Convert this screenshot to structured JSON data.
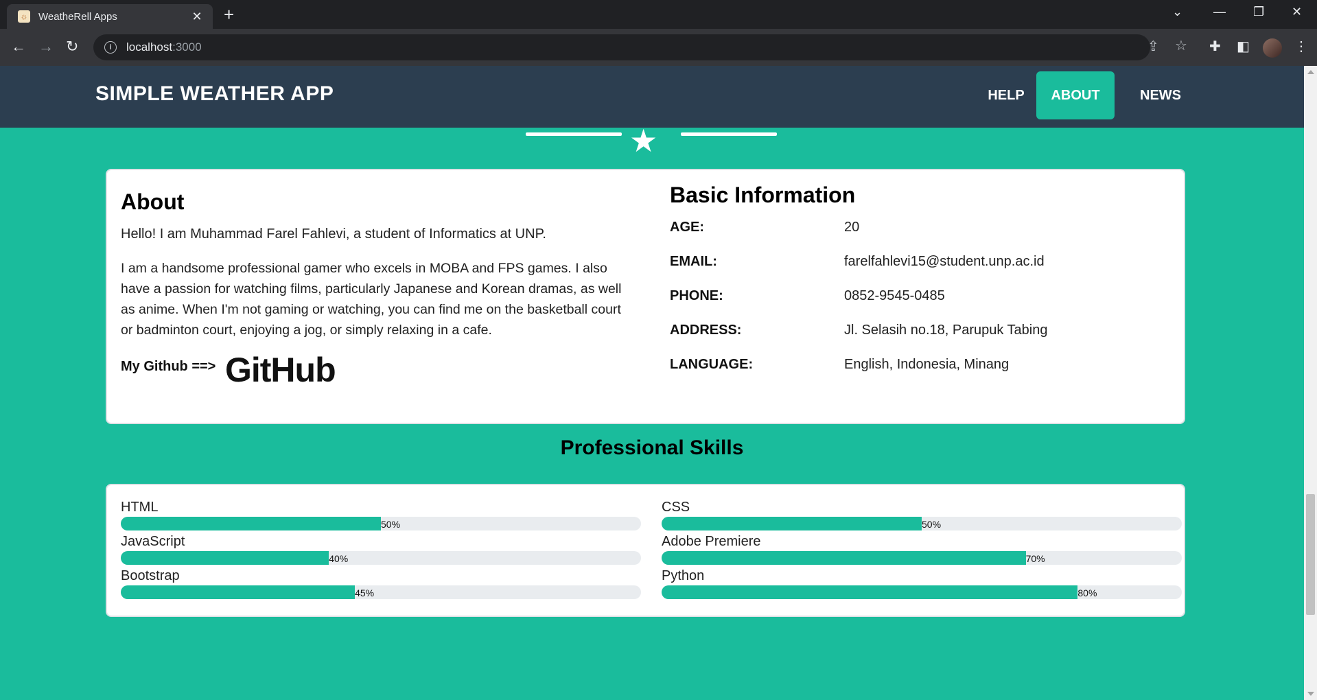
{
  "browser": {
    "tab_title": "WeatheRell Apps",
    "tab_close": "✕",
    "new_tab": "+",
    "url_host": "localhost",
    "url_port": ":3000"
  },
  "site": {
    "brand": "SIMPLE WEATHER APP",
    "nav": [
      {
        "label": "HELP",
        "active": false
      },
      {
        "label": "ABOUT",
        "active": true
      },
      {
        "label": "NEWS",
        "active": false
      }
    ]
  },
  "about": {
    "heading": "About",
    "intro": "Hello! I am Muhammad Farel Fahlevi, a student of Informatics at UNP.",
    "bio": "I am a handsome professional gamer who excels in MOBA and FPS games. I also have a passion for watching films, particularly Japanese and Korean dramas, as well as anime. When I'm not gaming or watching, you can find me on the basketball court or badminton court, enjoying a jog, or simply relaxing in a cafe.",
    "github_label": "My Github ==>",
    "github_logo_text": "GitHub"
  },
  "basic_info": {
    "heading": "Basic Information",
    "rows": [
      {
        "label": "AGE:",
        "value": "20"
      },
      {
        "label": "EMAIL:",
        "value": "farelfahlevi15@student.unp.ac.id"
      },
      {
        "label": "PHONE:",
        "value": "0852-9545-0485"
      },
      {
        "label": "ADDRESS:",
        "value": "Jl. Selasih no.18, Parupuk Tabing"
      },
      {
        "label": "LANGUAGE:",
        "value": "English, Indonesia, Minang"
      }
    ]
  },
  "skills": {
    "title": "Professional Skills",
    "items": [
      {
        "name": "HTML",
        "percent": 50,
        "label": "50%"
      },
      {
        "name": "CSS",
        "percent": 50,
        "label": "50%"
      },
      {
        "name": "JavaScript",
        "percent": 40,
        "label": "40%"
      },
      {
        "name": "Adobe Premiere",
        "percent": 70,
        "label": "70%"
      },
      {
        "name": "Bootstrap",
        "percent": 45,
        "label": "45%"
      },
      {
        "name": "Python",
        "percent": 80,
        "label": "80%"
      }
    ]
  },
  "colors": {
    "accent": "#1abc9c",
    "navbar": "#2c3e50",
    "track": "#e9ecef"
  }
}
